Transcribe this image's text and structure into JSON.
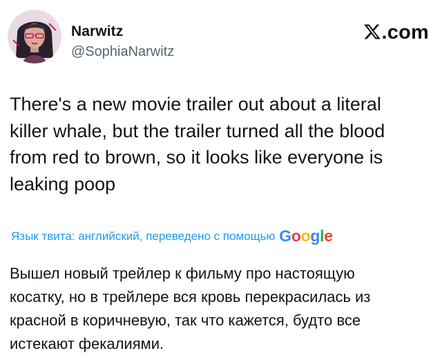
{
  "author": {
    "display_name": "Narwitz",
    "handle": "@SophiaNarwitz",
    "avatar_icon": "avatar-illustration"
  },
  "brand": {
    "logo_icon": "x-logo-icon",
    "text": ".com"
  },
  "tweet": {
    "text": "There's a new movie trailer out about a literal\nkiller whale, but the trailer turned all the blood\nfrom red to brown, so it looks like everyone is\nleaking poop"
  },
  "translation": {
    "note": "Язык твита: английский, переведено с помощью",
    "provider": [
      "G",
      "o",
      "o",
      "g",
      "l",
      "e"
    ],
    "provider_colors": [
      "#4285F4",
      "#EA4335",
      "#FBBC05",
      "#4285F4",
      "#34A853",
      "#EA4335"
    ],
    "text": "Вышел новый трейлер к фильму про настоящую\nкосатку, но в трейлере вся кровь перекрасилась из\nкрасной в коричневую, так что кажется, будто все\nистекают фекалиями."
  },
  "colors": {
    "link_blue": "#1d9bf0",
    "secondary_text": "#536471",
    "primary_text": "#0f1419"
  }
}
